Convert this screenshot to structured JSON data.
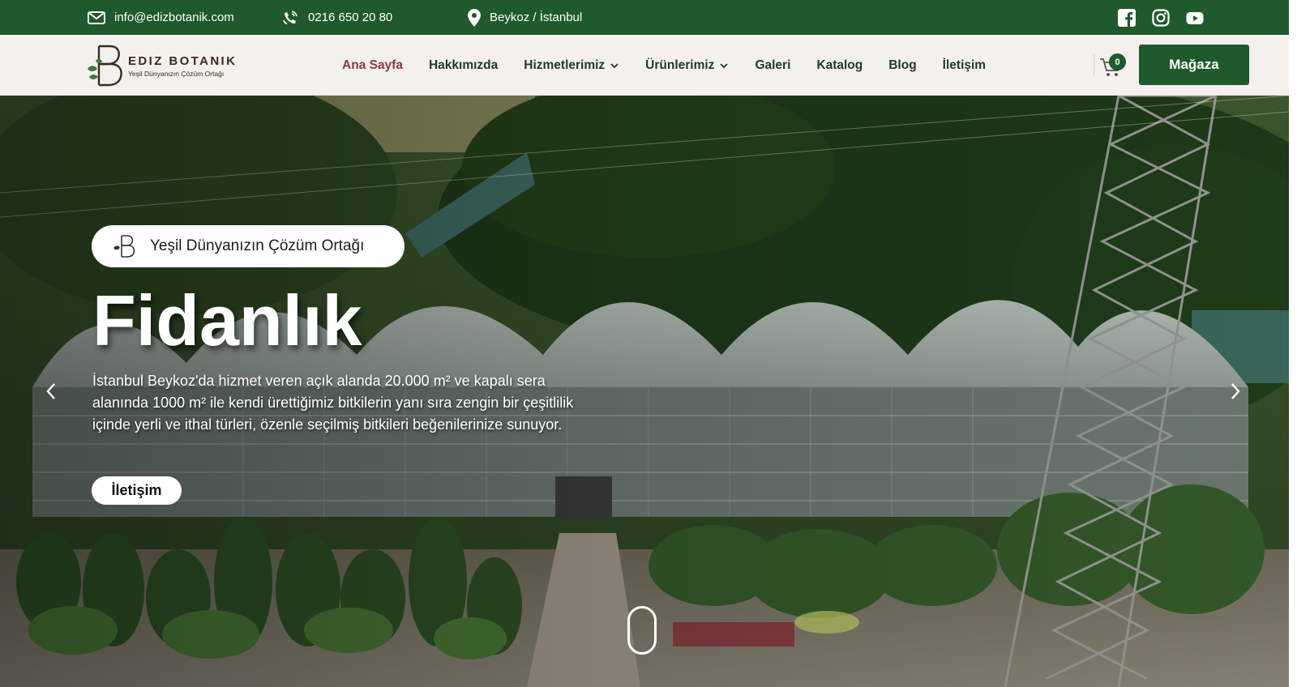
{
  "topbar": {
    "email": "info@edizbotanik.com",
    "phone": "0216 650 20 80",
    "location": "Beykoz / İstanbul",
    "icons": [
      "mail-icon",
      "phone-icon",
      "location-pin-icon"
    ],
    "social": [
      "facebook-icon",
      "instagram-icon",
      "youtube-icon"
    ]
  },
  "logo": {
    "title": "EDIZ BOTANIK",
    "subtitle": "Yeşil Dünyanızın Çözüm Ortağı"
  },
  "nav": {
    "items": [
      {
        "label": "Ana Sayfa",
        "active": true
      },
      {
        "label": "Hakkımızda"
      },
      {
        "label": "Hizmetlerimiz",
        "dropdown": true
      },
      {
        "label": "Ürünlerimiz",
        "dropdown": true
      },
      {
        "label": "Galeri"
      },
      {
        "label": "Katalog"
      },
      {
        "label": "Blog"
      },
      {
        "label": "İletişim"
      }
    ]
  },
  "cart": {
    "count": "0",
    "icon": "cart-icon"
  },
  "shop_button": "Mağaza",
  "hero": {
    "badge_text": "Yeşil Dünyanızın Çözüm Ortağı",
    "title": "Fidanlık",
    "description": "İstanbul Beykoz'da hizmet veren açık alanda 20.000 m² ve kapalı sera alanında 1000 m² ile kendi ürettiğimiz bitkilerin yanı sıra zengin bir çeşitlilik içinde yerli ve ithal türleri, özenle seçilmiş bitkileri beğenilerinize sunuyor.",
    "button_label": "İletişim"
  },
  "colors": {
    "brand_green": "#1f5a2c",
    "active_nav": "#8b3a3a",
    "header_bg": "#f4f1ed"
  }
}
